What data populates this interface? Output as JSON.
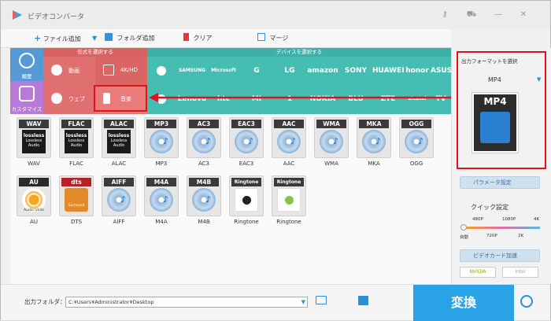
{
  "window": {
    "title": "ビデオコンバータ"
  },
  "toolbar": {
    "add_file": "ファイル追加",
    "add_folder": "フォルダ追加",
    "clear": "クリア",
    "merge": "マージ"
  },
  "categories": [
    {
      "label": "履歴",
      "icon": "history-icon"
    },
    {
      "label": "カスタマイズ",
      "icon": "customize-icon"
    }
  ],
  "format_select": {
    "header": "形式を選択する",
    "items": [
      {
        "label": "動画",
        "icon": "play-icon"
      },
      {
        "label": "4K/HD",
        "icon": "4k-icon"
      },
      {
        "label": "ウェブ",
        "icon": "chrome-icon"
      },
      {
        "label": "音楽",
        "icon": "speaker-icon"
      }
    ]
  },
  "device_select": {
    "header": "デバイスを選択する",
    "row1": [
      "",
      "SAMSUNG",
      "Microsoft",
      "G",
      "LG",
      "amazon",
      "SONY",
      "HUAWEI",
      "honor",
      "ASUS"
    ],
    "row2": [
      "",
      "Lenovo",
      "htc",
      "MI",
      "1",
      "NOKIA",
      "BLU",
      "ZTE",
      "alcatel",
      "TV"
    ]
  },
  "audio_formats": [
    {
      "badge": "WAV",
      "label": "WAV"
    },
    {
      "badge": "FLAC",
      "label": "FLAC"
    },
    {
      "badge": "ALAC",
      "label": "ALAC"
    },
    {
      "badge": "MP3",
      "label": "MP3"
    },
    {
      "badge": "AC3",
      "label": "AC3"
    },
    {
      "badge": "EAC3",
      "label": "EAC3"
    },
    {
      "badge": "AAC",
      "label": "AAC"
    },
    {
      "badge": "WMA",
      "label": "WMA"
    },
    {
      "badge": "MKA",
      "label": "MKA"
    },
    {
      "badge": "OGG",
      "label": "OGG"
    },
    {
      "badge": "AU",
      "label": "AU"
    },
    {
      "badge": "dts",
      "label": "DTS"
    },
    {
      "badge": "AIFF",
      "label": "AIFF"
    },
    {
      "badge": "M4A",
      "label": "M4A"
    },
    {
      "badge": "M4B",
      "label": "M4B"
    },
    {
      "badge": "Ringtone",
      "label": "Ringtone"
    },
    {
      "badge": "Ringtone",
      "label": "Ringtone"
    }
  ],
  "tile_art_text": {
    "lossless": "lossless",
    "lossless_audio": "Lossless Audio",
    "audio_units": "Audio Units",
    "surround": "Surround"
  },
  "output_panel": {
    "title": "出力フォーマットを選択",
    "selected_format": "MP4",
    "preview_label": "MP4",
    "param_button": "パラメータ設定",
    "quick_title": "クイック設定",
    "quality_top": [
      "480P",
      "1080P",
      "4K"
    ],
    "quality_bottom": [
      "自動",
      "720P",
      "2K"
    ],
    "quality_level": 0,
    "gpu_button": "ビデオカード加速",
    "gpu_nvidia": "NVIDIA",
    "gpu_intel": "Intel"
  },
  "bottom": {
    "folder_label": "出力フォルダ：",
    "folder_path": "C:¥Users¥Administrator¥Desktop",
    "convert_label": "変換"
  },
  "colors": {
    "accent_blue": "#2aa3e6",
    "format_red": "#e06f6f",
    "device_teal": "#46bdb3",
    "highlight_red": "#e0121b"
  }
}
